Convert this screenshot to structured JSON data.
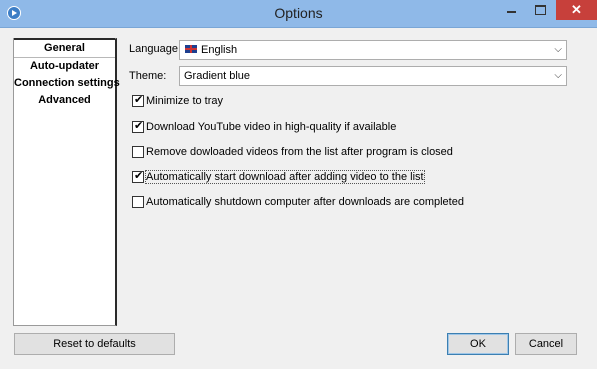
{
  "window": {
    "title": "Options",
    "close_glyph": "✕"
  },
  "nav": {
    "items": [
      "General",
      "Auto-updater",
      "Connection settings",
      "Advanced"
    ],
    "selected": "General"
  },
  "general": {
    "language_label": "Language:",
    "language_value": "English",
    "theme_label": "Theme:",
    "theme_value": "Gradient blue",
    "options": [
      {
        "label": "Minimize to tray",
        "checked": true
      },
      {
        "label": "Download YouTube video in high-quality if available",
        "checked": true
      },
      {
        "label": "Remove dowloaded videos from the list after program is closed",
        "checked": false
      },
      {
        "label": "Automatically start download after adding video to the list",
        "checked": true
      },
      {
        "label": "Automatically shutdown computer after downloads are completed",
        "checked": false
      }
    ]
  },
  "buttons": {
    "reset": "Reset to defaults",
    "ok": "OK",
    "cancel": "Cancel"
  }
}
